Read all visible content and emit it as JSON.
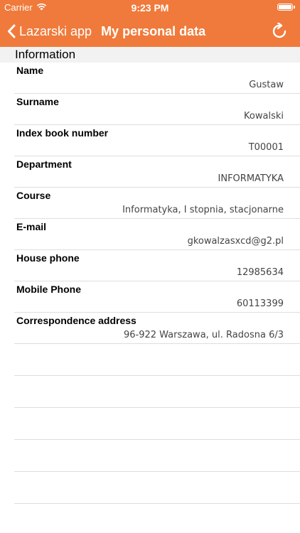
{
  "status": {
    "carrier": "Carrier",
    "time": "9:23 PM"
  },
  "nav": {
    "back_label": "Lazarski app",
    "title": "My personal data"
  },
  "section": {
    "title": "Information"
  },
  "fields": [
    {
      "label": "Name",
      "value": "Gustaw"
    },
    {
      "label": "Surname",
      "value": "Kowalski"
    },
    {
      "label": "Index book number",
      "value": "T00001"
    },
    {
      "label": "Department",
      "value": "INFORMATYKA"
    },
    {
      "label": "Course",
      "value": "Informatyka, I stopnia, stacjonarne"
    },
    {
      "label": "E-mail",
      "value": "gkowalzasxcd@g2.pl"
    },
    {
      "label": "House phone",
      "value": "12985634"
    },
    {
      "label": "Mobile Phone",
      "value": "60113399"
    },
    {
      "label": "Correspondence address",
      "value": "96-922 Warszawa, ul. Radosna 6/3"
    }
  ],
  "colors": {
    "accent": "#f07a3b"
  },
  "icons": {
    "back": "chevron-left-icon",
    "refresh": "refresh-icon",
    "wifi": "wifi-icon",
    "battery": "battery-icon"
  }
}
